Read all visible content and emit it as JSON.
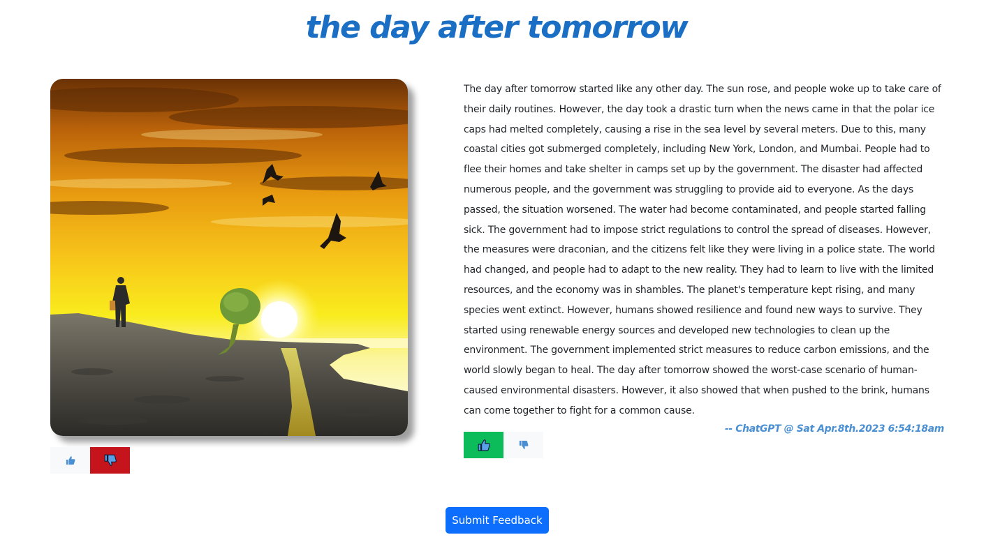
{
  "page": {
    "title": "the day after tomorrow"
  },
  "image": {
    "alt": "the day after tomorrow"
  },
  "image_feedback": {
    "up": {
      "icon": "thumbs-up-icon",
      "selected": false
    },
    "down": {
      "icon": "thumbs-down-icon",
      "selected": true
    }
  },
  "story": {
    "text": "The day after tomorrow started like any other day. The sun rose, and people woke up to take care of their daily routines. However, the day took a drastic turn when the news came in that the polar ice caps had melted completely, causing a rise in the sea level by several meters. Due to this, many coastal cities got submerged completely, including New York, London, and Mumbai. People had to flee their homes and take shelter in camps set up by the government. The disaster had affected numerous people, and the government was struggling to provide aid to everyone. As the days passed, the situation worsened. The water had become contaminated, and people started falling sick. The government had to impose strict regulations to control the spread of diseases. However, the measures were draconian, and the citizens felt like they were living in a police state. The world had changed, and people had to adapt to the new reality. They had to learn to live with the limited resources, and the economy was in shambles. The planet's temperature kept rising, and many species went extinct. However, humans showed resilience and found new ways to survive. They started using renewable energy sources and developed new technologies to clean up the environment. The government implemented strict measures to reduce carbon emissions, and the world slowly began to heal. The day after tomorrow showed the worst-case scenario of human-caused environmental disasters. However, it also showed that when pushed to the brink, humans can come together to fight for a common cause.",
    "attribution": "-- ChatGPT @ Sat Apr.8th.2023 6:54:18am"
  },
  "story_feedback": {
    "up": {
      "icon": "thumbs-up-icon",
      "selected": true
    },
    "down": {
      "icon": "thumbs-down-icon",
      "selected": false
    }
  },
  "submit": {
    "label": "Submit Feedback"
  },
  "colors": {
    "title": "#1a6fc4",
    "attribution": "#4a8fd2",
    "upvote_active": "#0cbc5b",
    "downvote_active": "#c5141c",
    "button_neutral": "#f8f9fa",
    "submit": "#0d6efd"
  }
}
